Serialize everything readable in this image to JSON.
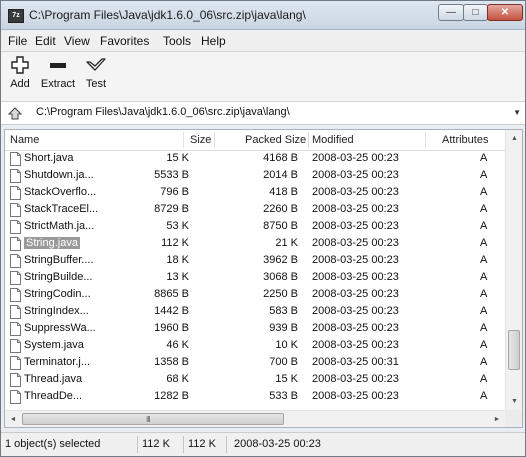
{
  "window": {
    "title": "C:\\Program Files\\Java\\jdk1.6.0_06\\src.zip\\java\\lang\\",
    "app_icon_text": "7z",
    "minimize_glyph": "—",
    "maximize_glyph": "□",
    "close_glyph": "✕"
  },
  "menu": [
    "File",
    "Edit",
    "View",
    "Favorites",
    "Tools",
    "Help"
  ],
  "toolbar": {
    "add_label": "Add",
    "extract_label": "Extract",
    "test_label": "Test"
  },
  "address": {
    "path": "C:\\Program Files\\Java\\jdk1.6.0_06\\src.zip\\java\\lang\\"
  },
  "columns": {
    "name": "Name",
    "size": "Size",
    "packed": "Packed Size",
    "modified": "Modified",
    "attributes": "Attributes"
  },
  "rows": [
    {
      "name": "Short.java",
      "size": "15 K",
      "packed": "4168 B",
      "modified": "2008-03-25 00:23",
      "attr": "A",
      "selected": false
    },
    {
      "name": "Shutdown.ja...",
      "size": "5533 B",
      "packed": "2014 B",
      "modified": "2008-03-25 00:23",
      "attr": "A",
      "selected": false
    },
    {
      "name": "StackOverflo...",
      "size": "796 B",
      "packed": "418 B",
      "modified": "2008-03-25 00:23",
      "attr": "A",
      "selected": false
    },
    {
      "name": "StackTraceEl...",
      "size": "8729 B",
      "packed": "2260 B",
      "modified": "2008-03-25 00:23",
      "attr": "A",
      "selected": false
    },
    {
      "name": "StrictMath.ja...",
      "size": "53 K",
      "packed": "8750 B",
      "modified": "2008-03-25 00:23",
      "attr": "A",
      "selected": false
    },
    {
      "name": "String.java",
      "size": "112 K",
      "packed": "21 K",
      "modified": "2008-03-25 00:23",
      "attr": "A",
      "selected": true
    },
    {
      "name": "StringBuffer....",
      "size": "18 K",
      "packed": "3962 B",
      "modified": "2008-03-25 00:23",
      "attr": "A",
      "selected": false
    },
    {
      "name": "StringBuilde...",
      "size": "13 K",
      "packed": "3068 B",
      "modified": "2008-03-25 00:23",
      "attr": "A",
      "selected": false
    },
    {
      "name": "StringCodin...",
      "size": "8865 B",
      "packed": "2250 B",
      "modified": "2008-03-25 00:23",
      "attr": "A",
      "selected": false
    },
    {
      "name": "StringIndex...",
      "size": "1442 B",
      "packed": "583 B",
      "modified": "2008-03-25 00:23",
      "attr": "A",
      "selected": false
    },
    {
      "name": "SuppressWa...",
      "size": "1960 B",
      "packed": "939 B",
      "modified": "2008-03-25 00:23",
      "attr": "A",
      "selected": false
    },
    {
      "name": "System.java",
      "size": "46 K",
      "packed": "10 K",
      "modified": "2008-03-25 00:23",
      "attr": "A",
      "selected": false
    },
    {
      "name": "Terminator.j...",
      "size": "1358 B",
      "packed": "700 B",
      "modified": "2008-03-25 00:31",
      "attr": "A",
      "selected": false
    },
    {
      "name": "Thread.java",
      "size": "68 K",
      "packed": "15 K",
      "modified": "2008-03-25 00:23",
      "attr": "A",
      "selected": false
    },
    {
      "name": "ThreadDe...",
      "size": "1282 B",
      "packed": "533 B",
      "modified": "2008-03-25 00:23",
      "attr": "A",
      "selected": false
    }
  ],
  "scroll": {
    "hgrip": "III"
  },
  "status": {
    "selected": "1 object(s) selected",
    "size": "112 K",
    "packed": "112 K",
    "modified": "2008-03-25 00:23"
  }
}
